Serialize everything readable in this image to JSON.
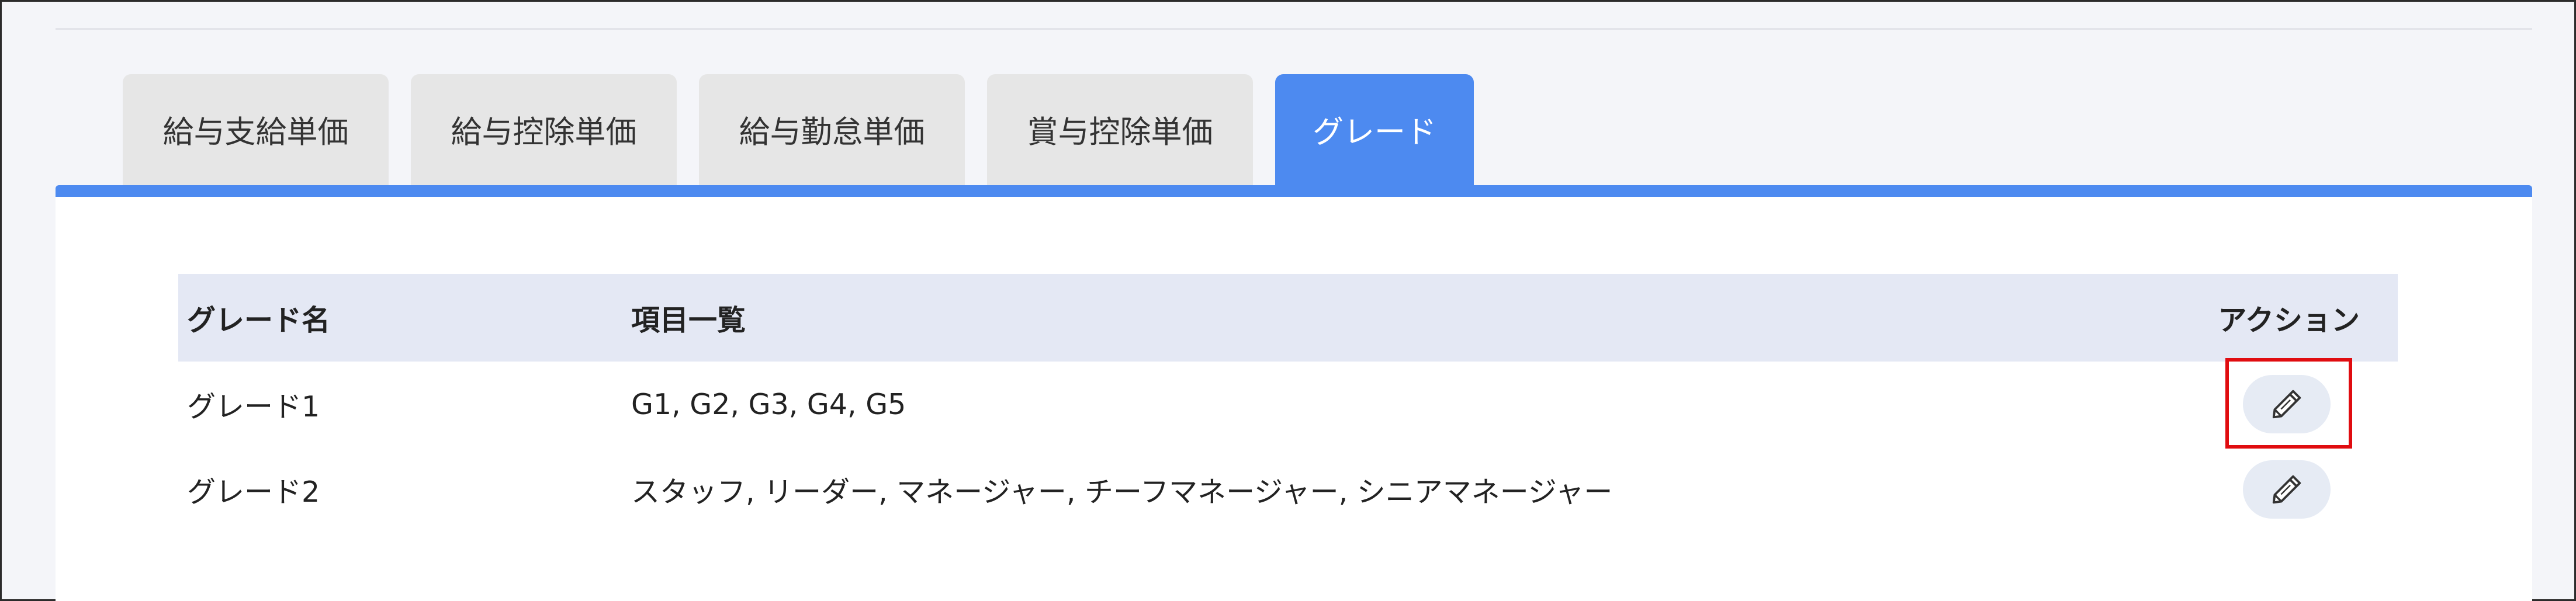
{
  "tabs": [
    {
      "label": "給与支給単価",
      "active": false
    },
    {
      "label": "給与控除単価",
      "active": false
    },
    {
      "label": "給与勤怠単価",
      "active": false
    },
    {
      "label": "賞与控除単価",
      "active": false
    },
    {
      "label": "グレード",
      "active": true
    }
  ],
  "table": {
    "headers": {
      "name": "グレード名",
      "items": "項目一覧",
      "action": "アクション"
    },
    "rows": [
      {
        "name": "グレード1",
        "items": "G1, G2, G3, G4, G5",
        "action_icon": "pencil-icon",
        "highlighted": true
      },
      {
        "name": "グレード2",
        "items": "スタッフ, リーダー, マネージャー, チーフマネージャー, シニアマネージャー",
        "action_icon": "pencil-icon",
        "highlighted": false
      }
    ]
  },
  "colors": {
    "accent": "#4d8af0",
    "highlight": "#e00c10",
    "header_bg": "#e4e8f4",
    "tab_bg": "#e6e6e6"
  }
}
